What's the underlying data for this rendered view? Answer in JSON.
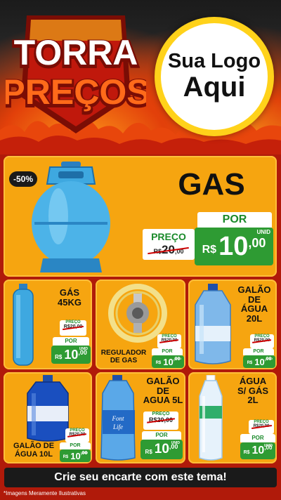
{
  "banner": {
    "title_line1": "TORRA",
    "title_line2": "PREÇOS",
    "logo_line1": "Sua Logo",
    "logo_line2": "Aqui"
  },
  "featured": {
    "discount": "-50%",
    "name": "GAS",
    "price_label": "PREÇO",
    "old_price_currency": "R$",
    "old_price": "20",
    "old_price_cents": ",00",
    "por_label": "POR",
    "unit_label": "UNID",
    "currency": "R$",
    "new_price_int": "10",
    "new_price_dec": ",00"
  },
  "products": [
    {
      "name_lines": [
        "GÁS",
        "45KG"
      ],
      "price_label": "PREÇO",
      "old_price": "R$20,00",
      "por_label": "POR",
      "unit_label": "UNID",
      "currency": "R$",
      "price_int": "10",
      "price_dec": ",00"
    },
    {
      "name_lines": [
        "REGULADOR",
        "DE GAS"
      ],
      "price_label": "PREÇO",
      "old_price": "R$20,00",
      "por_label": "POR",
      "unit_label": "UNID",
      "currency": "R$",
      "price_int": "10",
      "price_dec": ",00"
    },
    {
      "name_lines": [
        "GALÃO",
        "DE",
        "ÁGUA",
        "20L"
      ],
      "price_label": "PREÇO",
      "old_price": "R$20,00",
      "por_label": "POR",
      "unit_label": "UNID",
      "currency": "R$",
      "price_int": "10",
      "price_dec": ",00"
    },
    {
      "name_lines": [
        "GALÃO DE",
        "ÁGUA 10L"
      ],
      "price_label": "PREÇO",
      "old_price": "R$20,00",
      "por_label": "POR",
      "unit_label": "UNID",
      "currency": "R$",
      "price_int": "10",
      "price_dec": ",00"
    },
    {
      "name_lines": [
        "GALÃO",
        "DE",
        "AGUA 5L"
      ],
      "price_label": "PREÇO",
      "old_price": "R$20,00",
      "por_label": "POR",
      "unit_label": "UNID",
      "currency": "R$",
      "price_int": "10",
      "price_dec": ",00"
    },
    {
      "name_lines": [
        "ÁGUA",
        "S/ GÁS",
        "2L"
      ],
      "price_label": "PREÇO",
      "old_price": "R$20,00",
      "por_label": "POR",
      "unit_label": "UNID",
      "currency": "R$",
      "price_int": "10",
      "price_dec": ",00"
    }
  ],
  "bottle_labels": {
    "font_life_line1": "Font",
    "font_life_line2": "Life"
  },
  "footer": {
    "cta": "Crie seu encarte com este tema!",
    "disclaimer": "*Imagens Meramente Ilustrativas"
  },
  "colors": {
    "card_bg": "#f6a510",
    "price_green": "#2e9b33",
    "badge_dark": "#1a1a1a",
    "logo_ring": "#ffd21a",
    "title_red": "#e2231a"
  }
}
